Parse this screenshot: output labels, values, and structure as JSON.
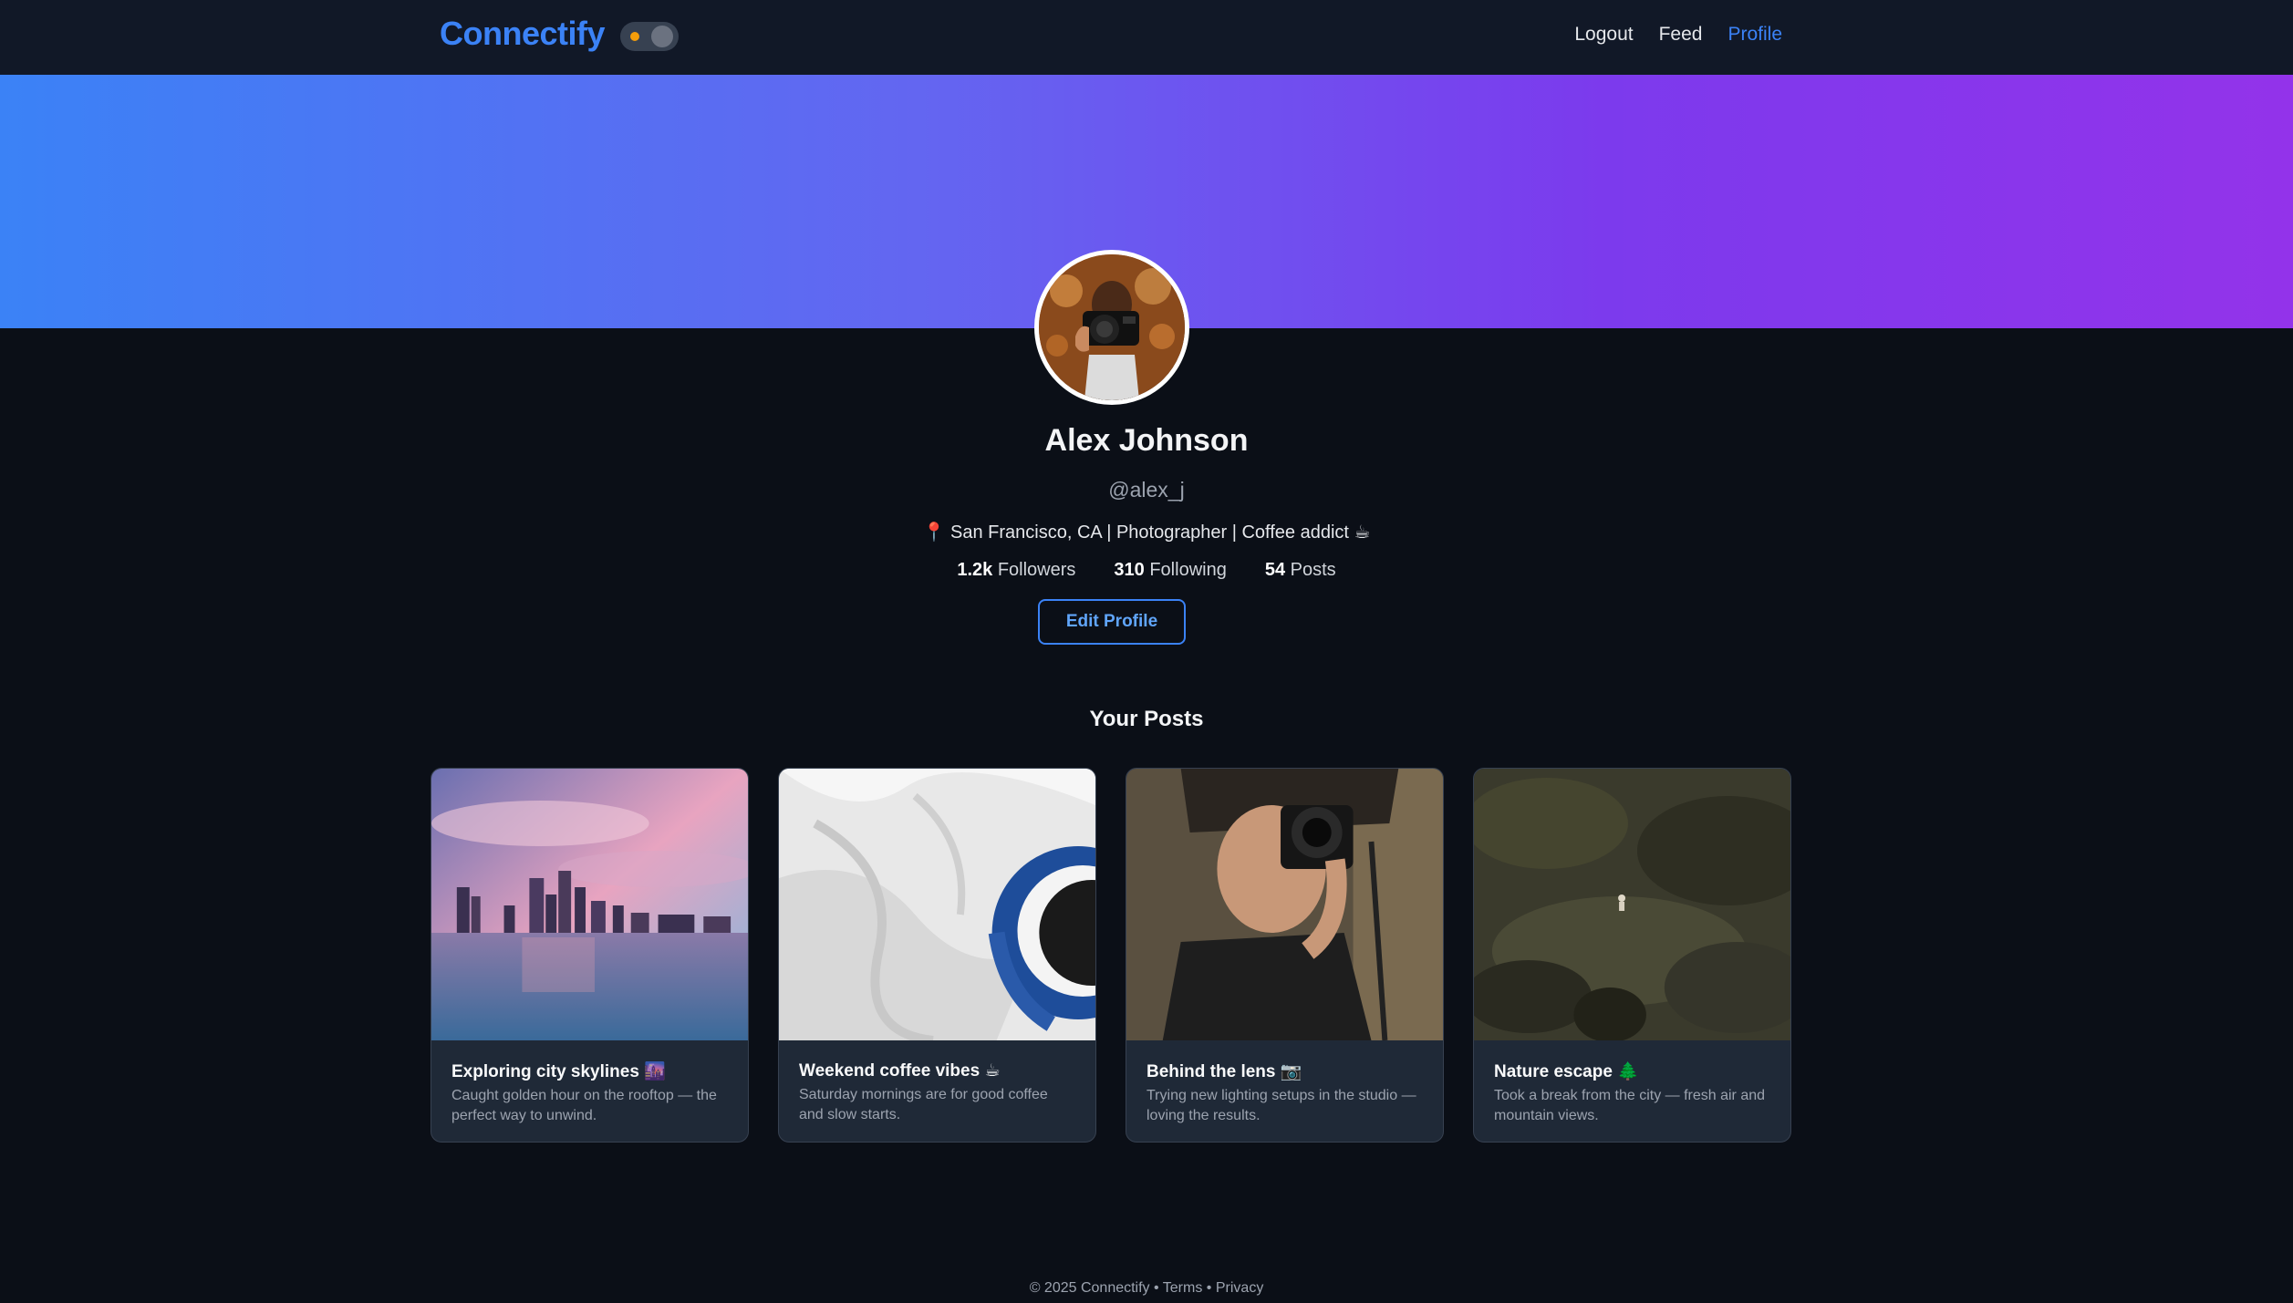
{
  "nav": {
    "brand": "Connectify",
    "links": [
      "Logout",
      "Feed",
      "Profile"
    ],
    "active": "Profile"
  },
  "profile": {
    "name": "Alex Johnson",
    "handle": "@alex_j",
    "bio": "📍 San Francisco, CA | Photographer | Coffee addict ☕",
    "stats": [
      {
        "value": "1.2k",
        "label": "Followers"
      },
      {
        "value": "310",
        "label": "Following"
      },
      {
        "value": "54",
        "label": "Posts"
      }
    ],
    "edit_label": "Edit Profile"
  },
  "posts_section": {
    "title": "Your Posts",
    "posts": [
      {
        "title": "Exploring city skylines 🌆",
        "desc": "Caught golden hour on the rooftop — the perfect way to unwind.",
        "image": "city-skyline-image"
      },
      {
        "title": "Weekend coffee vibes ☕",
        "desc": "Saturday mornings are for good coffee and slow starts.",
        "image": "coffee-cup-image"
      },
      {
        "title": "Behind the lens 📷",
        "desc": "Trying new lighting setups in the studio — loving the results.",
        "image": "photographer-image"
      },
      {
        "title": "Nature escape 🌲",
        "desc": "Took a break from the city — fresh air and mountain views.",
        "image": "nature-image"
      }
    ]
  },
  "footer": {
    "copyright": "© 2025 Connectify",
    "sep": "•",
    "terms": "Terms",
    "privacy": "Privacy"
  },
  "colors": {
    "accent": "#3b82f6",
    "banner_start": "#3b82f6",
    "banner_end": "#9333ea",
    "background": "#0b0f17",
    "card": "#1f2937"
  }
}
